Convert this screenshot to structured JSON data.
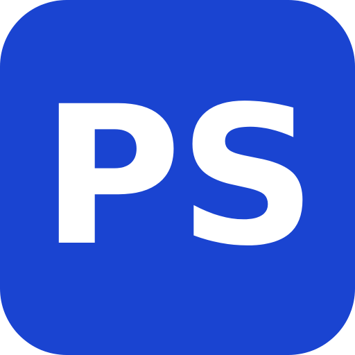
{
  "icon": {
    "text": "PS",
    "background_color": "#1a44d1",
    "text_color": "#ffffff"
  }
}
